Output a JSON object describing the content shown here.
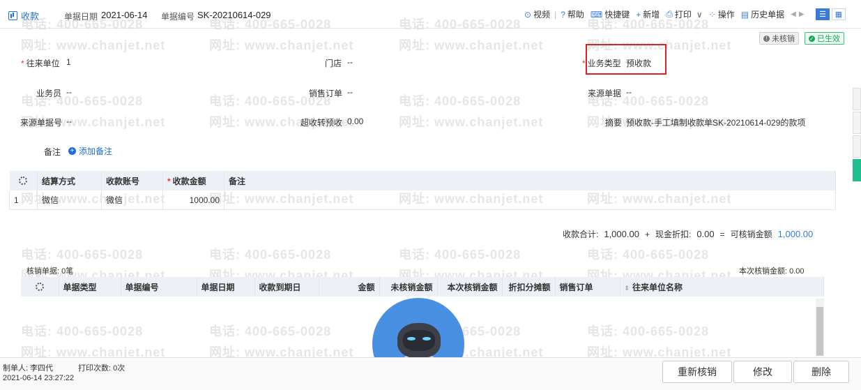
{
  "header": {
    "tab_label": "收款",
    "date_label": "单据日期",
    "date_value": "2021-06-14",
    "number_label": "单据编号",
    "number_value": "SK-20210614-029"
  },
  "toolbar": {
    "video": "视频",
    "help": "帮助",
    "shortcut": "快捷键",
    "add": "新增",
    "print": "打印",
    "operate": "操作",
    "history": "历史单据"
  },
  "status": {
    "unverified": "未核销",
    "effective": "已生效"
  },
  "form": {
    "partner_label": "往来单位",
    "partner_value": "1",
    "store_label": "门店",
    "store_value": "--",
    "biztype_label": "业务类型",
    "biztype_value": "预收款",
    "salesman_label": "业务员",
    "salesman_value": "--",
    "sales_order_label": "销售订单",
    "sales_order_value": "--",
    "source_doc_label": "来源单据",
    "source_doc_value": "--",
    "source_no_label": "来源单据号",
    "source_no_value": "--",
    "overpay_label": "超收转预收",
    "overpay_value": "0.00",
    "summary_label": "摘要",
    "summary_value": "预收款-手工填制收款单SK-20210614-029的款项",
    "note_label": "备注",
    "add_note": "添加备注"
  },
  "payment_grid": {
    "headers": [
      "结算方式",
      "收款账号",
      "收款金额",
      "备注"
    ],
    "rows": [
      {
        "index": "1",
        "method": "微信",
        "account": "微信",
        "amount": "1000.00",
        "note": ""
      }
    ]
  },
  "totals": {
    "received_label": "收款合计:",
    "received_value": "1,000.00",
    "plus": "+",
    "discount_label": "现金折扣:",
    "discount_value": "0.00",
    "equals": "=",
    "verifiable_label": "可核销金额",
    "verifiable_value": "1,000.00"
  },
  "verify": {
    "count_label": "核销单据: 0笔",
    "this_amount_label": "本次核销金额: 0.00",
    "headers": [
      "单据类型",
      "单据编号",
      "单据日期",
      "收款到期日",
      "金额",
      "未核销金额",
      "本次核销金额",
      "折扣分摊额",
      "销售订单",
      "往来单位名称"
    ]
  },
  "footer": {
    "maker": "制单人: 李四代",
    "print_count": "打印次数: 0次",
    "timestamp": "2021-06-14 23:27:22",
    "reverify_btn": "重新核销",
    "modify_btn": "修改",
    "delete_btn": "删除"
  },
  "watermark": {
    "phone": "电话: 400-665-0028",
    "site": "网址: www.chanjet.net"
  },
  "colors": {
    "accent": "#1e6fd9",
    "required": "#e53935",
    "highlight_box": "#e02020",
    "effective": "#1aa35a",
    "grid_header": "#eef0f7"
  }
}
